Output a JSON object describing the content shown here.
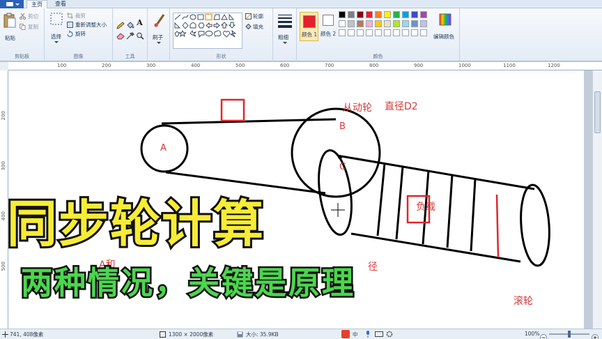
{
  "tabs": {
    "home": "主页",
    "view": "查看"
  },
  "clipboard": {
    "paste": "粘贴",
    "cut": "剪切",
    "copy": "复制",
    "group": "剪贴板"
  },
  "image": {
    "select": "选择",
    "crop": "裁剪",
    "resize": "重新调整大小",
    "rotate": "旋转",
    "group": "图像"
  },
  "tools": {
    "group": "工具",
    "text_glyph": "A"
  },
  "brushes": {
    "label": "刷子"
  },
  "shapes": {
    "outline": "轮廓",
    "fill": "填充",
    "group": "形状"
  },
  "size": {
    "label": "粗细"
  },
  "colors": {
    "color1": "颜色 1",
    "color2": "颜色 2",
    "edit": "编辑颜色",
    "group": "颜色",
    "palette": [
      "#000000",
      "#7f7f7f",
      "#880015",
      "#ed1c24",
      "#ff7f27",
      "#fff200",
      "#22b14c",
      "#00a2e8",
      "#3f48cc",
      "#a349a4",
      "#ffffff",
      "#c3c3c3",
      "#b97a57",
      "#ffaec9",
      "#ffc90e",
      "#efe4b0",
      "#b5e61d",
      "#99d9ea",
      "#7092be",
      "#c8bfe7",
      "#ffffff",
      "#ffffff",
      "#ffffff",
      "#ffffff",
      "#ffffff",
      "#ffffff",
      "#ffffff",
      "#ffffff",
      "#ffffff",
      "#ffffff"
    ]
  },
  "ruler": {
    "h": [
      "100",
      "200",
      "300",
      "400",
      "500",
      "600",
      "700",
      "800",
      "900",
      "1000",
      "1100",
      "1200"
    ],
    "v": [
      "200",
      "300",
      "400",
      "500"
    ]
  },
  "drawing": {
    "label_A": "A",
    "label_B": "B",
    "label_C": "C",
    "driven_wheel": "从动轮",
    "diameter_d2": "直径D2",
    "load": "负载",
    "roller": "滚轮",
    "partial_left": "A和",
    "partial_mid": "径"
  },
  "overlay": {
    "title": "同步轮计算",
    "subtitle": "两种情况，关键是原理"
  },
  "status": {
    "cursor": "741, 408像素",
    "dimensions": "1300 × 2000像素",
    "filesize": "大小: 35.9KB",
    "zoom": "100%",
    "ime": "中"
  }
}
